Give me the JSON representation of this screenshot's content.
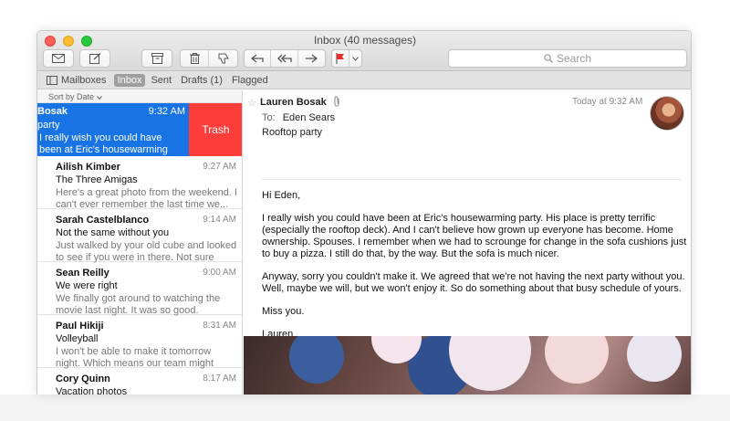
{
  "window": {
    "title": "Inbox (40 messages)"
  },
  "toolbar": {
    "search_placeholder": "Search"
  },
  "favorites": {
    "mailboxes": "Mailboxes",
    "inbox": "Inbox",
    "sent": "Sent",
    "drafts": "Drafts (1)",
    "flagged": "Flagged"
  },
  "list": {
    "sort_label": "Sort by Date",
    "trash_label": "Trash",
    "selected": {
      "sender": "Bosak",
      "time": "9:32 AM",
      "subject": "party",
      "preview": " I really wish you could have been at Eric's housewarming party. His place..."
    },
    "messages": [
      {
        "sender": "Ailish Kimber",
        "time": "9:27 AM",
        "subject": "The Three Amigas",
        "preview": "Here's a great photo from the weekend. I can't ever remember the last time we..."
      },
      {
        "sender": "Sarah Castelblanco",
        "time": "9:14 AM",
        "subject": "Not the same without you",
        "preview": "Just walked by your old cube and looked to see if you were in there. Not sure when I..."
      },
      {
        "sender": "Sean Reilly",
        "time": "9:00 AM",
        "subject": "We were right",
        "preview": "We finally got around to watching the movie last night. It was so good. Thanks..."
      },
      {
        "sender": "Paul Hikiji",
        "time": "8:31 AM",
        "subject": "Volleyball",
        "preview": "I won't be able to make it tomorrow night. Which means our team might actually win..."
      },
      {
        "sender": "Cory Quinn",
        "time": "8:17 AM",
        "subject": "Vacation photos",
        "preview": ""
      }
    ]
  },
  "message": {
    "from": "Lauren Bosak",
    "date": "Today at 9:32 AM",
    "to_label": "To:",
    "to": "Eden Sears",
    "subject": "Rooftop party",
    "greeting": "Hi Eden,",
    "para1": "I really wish you could have been at Eric's housewarming party. His place is pretty terrific (especially the rooftop deck). And I can't believe how grown up everyone has become. Home ownership. Spouses. I remember when we had to scrounge for change in the sofa cushions just to buy a pizza. I still do that, by the way. But the sofa is much nicer.",
    "para2": "Anyway, sorry you couldn't make it. We agreed that we're not having the next party without you. Well, maybe we will, but we won't enjoy it. So do something about that busy schedule of yours.",
    "closing": "Miss you.",
    "signature": "Lauren"
  }
}
